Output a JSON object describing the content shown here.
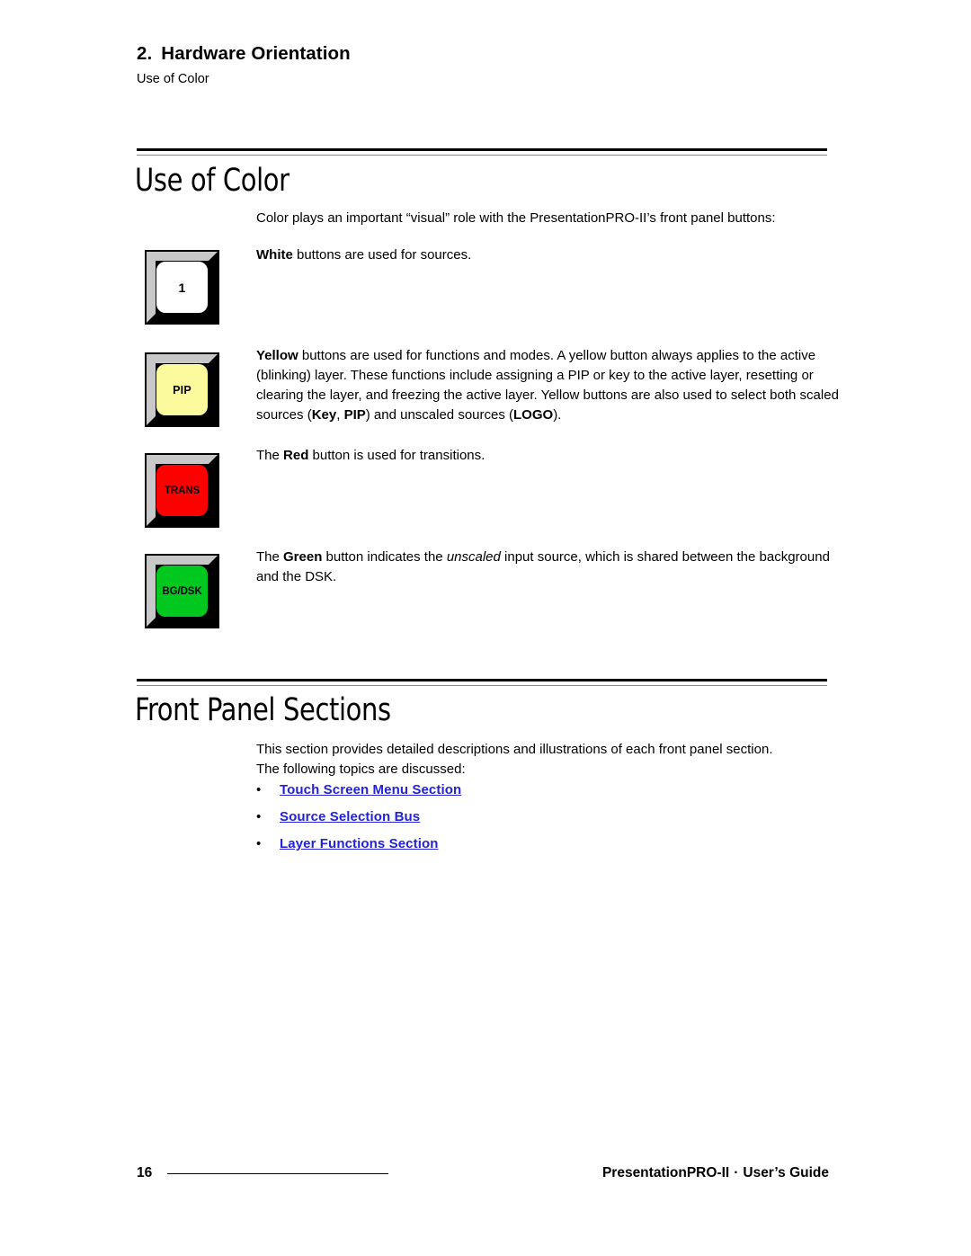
{
  "header": {
    "chapter_number": "2.",
    "chapter_title": "Hardware Orientation",
    "chapter_subtitle": "Use of Color"
  },
  "sections": [
    {
      "heading": "Use of Color",
      "intro": "Color plays an important “visual” role with the PresentationPRO-II’s front panel buttons:"
    },
    {
      "heading": "Front Panel Sections",
      "intro_line1": "This section provides detailed descriptions and illustrations of each front panel section.",
      "intro_line2": "The following topics are discussed:"
    }
  ],
  "buttons": [
    {
      "name": "source-button",
      "label": "1",
      "cap_color": "#ffffff",
      "bevel_light": "#c8c8c8",
      "bevel_dark": "#000000"
    },
    {
      "name": "pip-button",
      "label": "PIP",
      "cap_color": "#fbfa9c",
      "bevel_light": "#c8c8c8",
      "bevel_dark": "#000000"
    },
    {
      "name": "trans-button",
      "label": "TRANS",
      "cap_color": "#fe0000",
      "bevel_light": "#c8c8c8",
      "bevel_dark": "#000000"
    },
    {
      "name": "bgdsk-button",
      "label": "BG/DSK",
      "cap_color": "#00c81e",
      "bevel_light": "#c8c8c8",
      "bevel_dark": "#000000"
    }
  ],
  "color_descriptions": {
    "white": {
      "lead": "White",
      "rest": " buttons are used for sources."
    },
    "yellow": {
      "lead": "Yellow",
      "part1": " buttons are used for functions and modes.  A yellow button always applies to the active (blinking) layer.  These functions include assigning a PIP or key to the active layer, resetting or clearing the layer, and freezing the active layer.  Yellow buttons are also used to select both scaled sources (",
      "key": "Key",
      "comma": ", ",
      "pip": "PIP",
      "part2": ") and unscaled sources (",
      "logo": "LOGO",
      "part3": ")."
    },
    "red": {
      "prefix": "The ",
      "lead": "Red",
      "rest": " button is used for transitions."
    },
    "green": {
      "prefix": "The ",
      "lead": "Green",
      "mid": " button indicates the ",
      "italic": "unscaled",
      "rest": " input source, which is shared between the background and the DSK."
    }
  },
  "topic_links": [
    {
      "bullet": "•",
      "label": "Touch Screen Menu Section"
    },
    {
      "bullet": "•",
      "label": "Source Selection Bus"
    },
    {
      "bullet": "•",
      "label": "Layer Functions Section"
    }
  ],
  "link_color": "#2222dd",
  "footer": {
    "page_number": "16",
    "product": "PresentationPRO-II",
    "separator": "·",
    "doc_type": "User’s Guide"
  }
}
